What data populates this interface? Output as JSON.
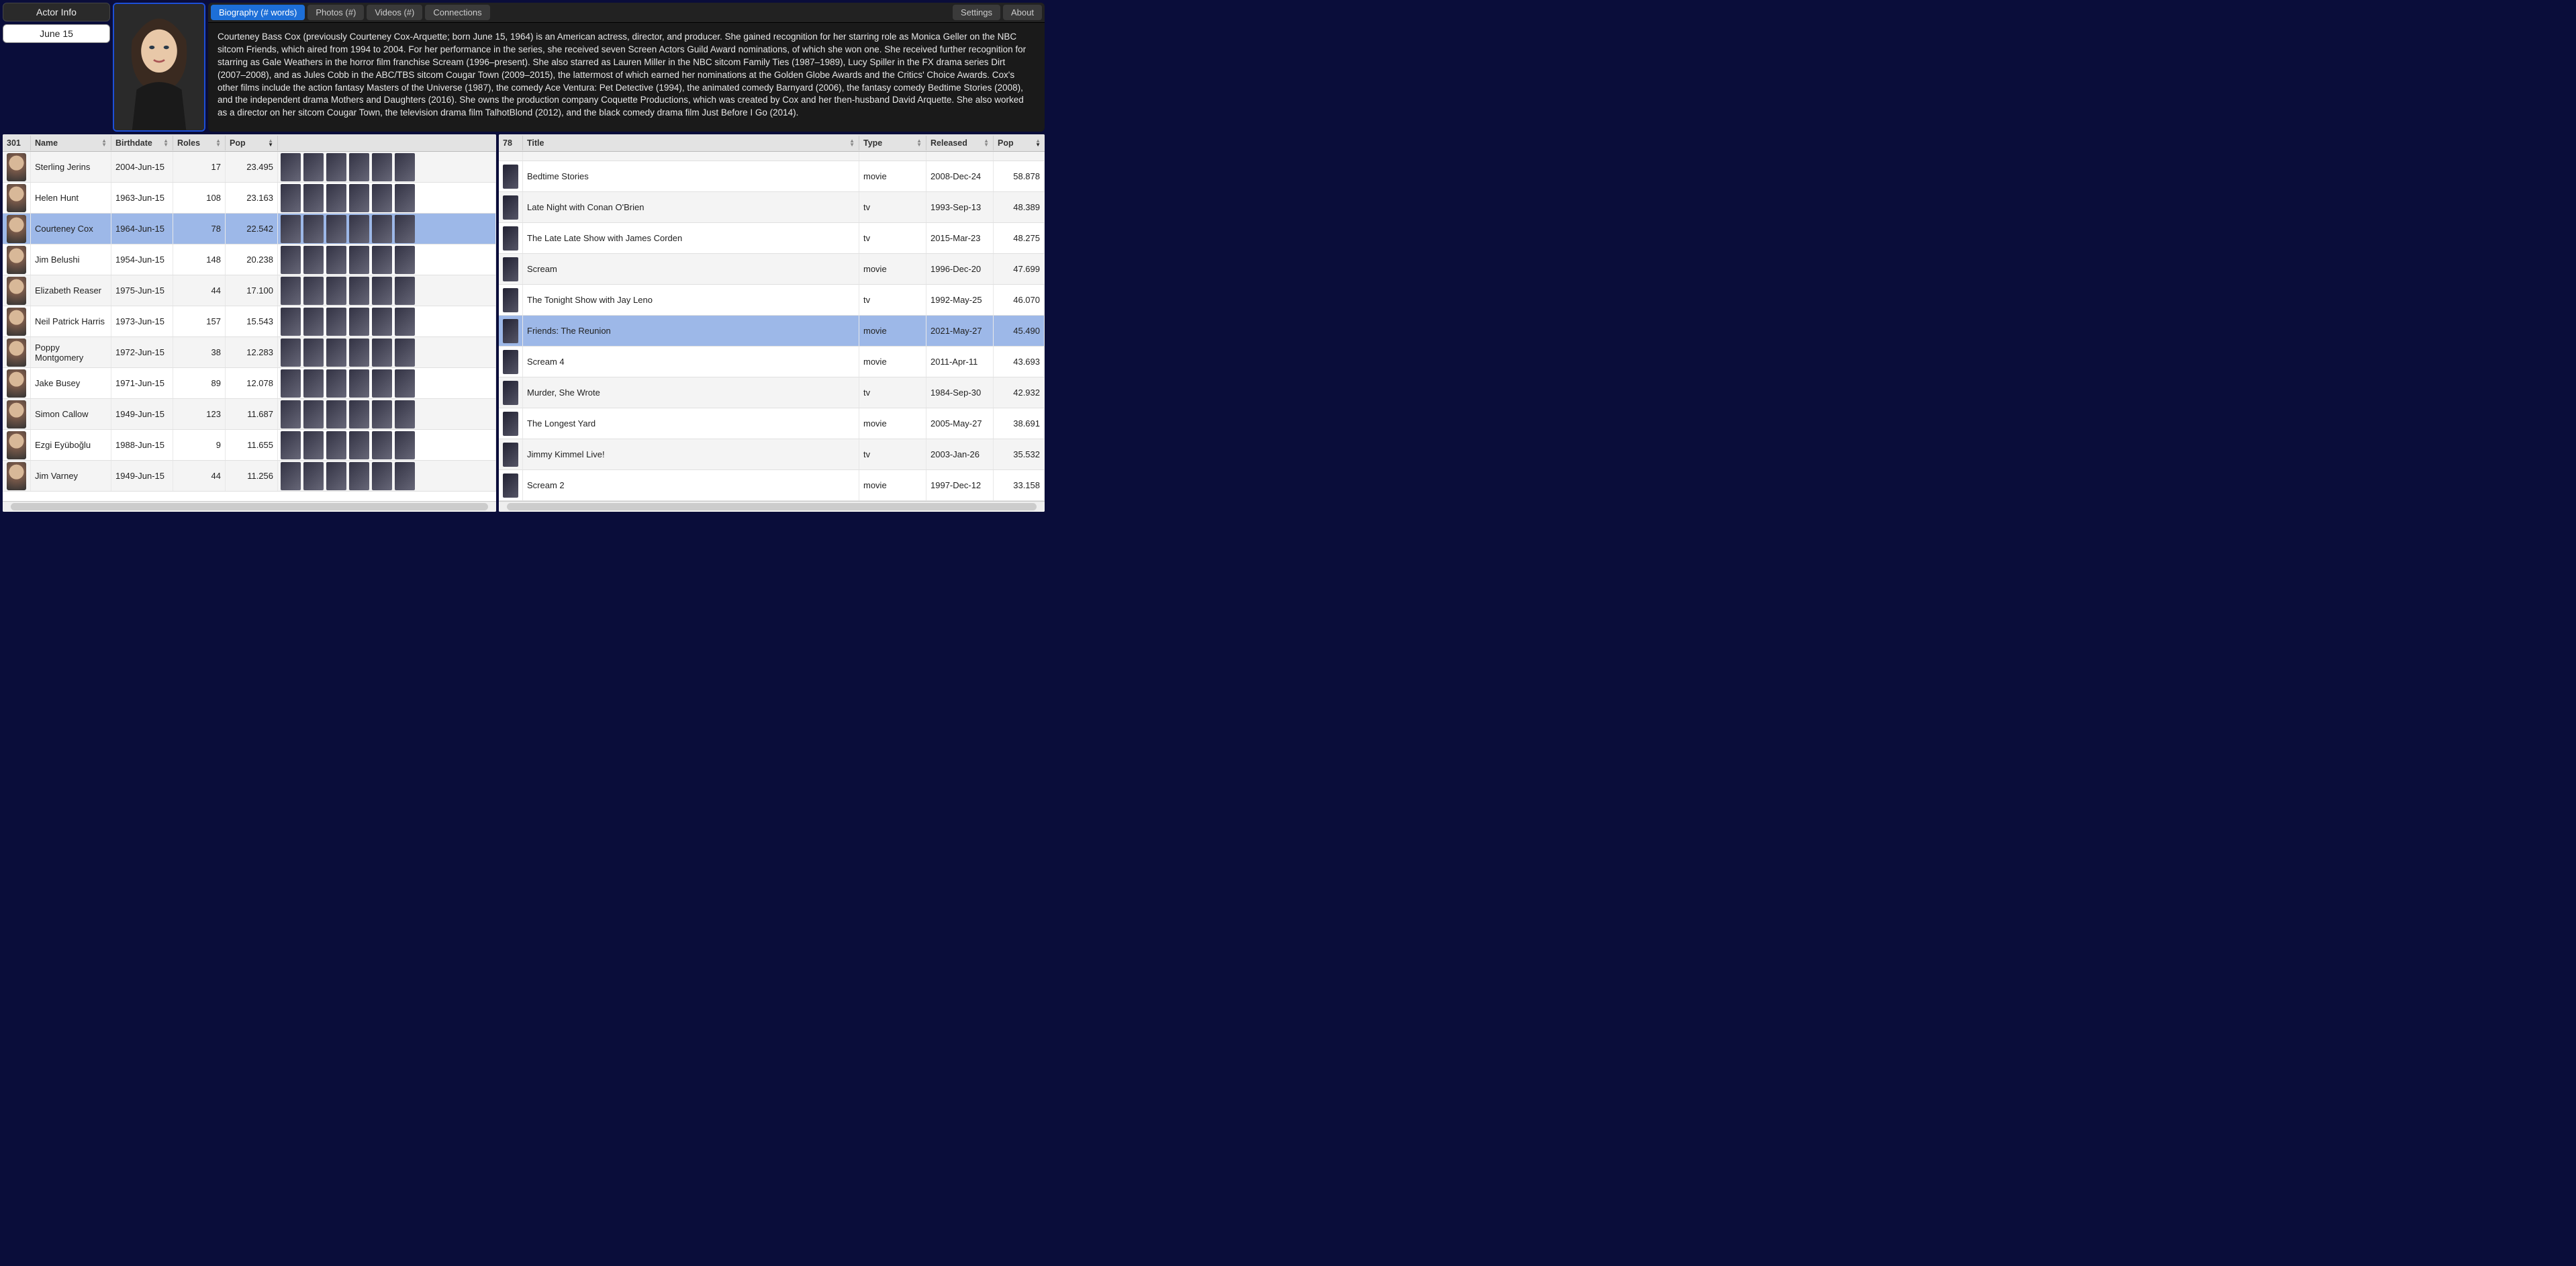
{
  "header": {
    "actor_info_label": "Actor Info",
    "date_label": "June 15"
  },
  "tabs": {
    "biography": "Biography (# words)",
    "photos": "Photos (#)",
    "videos": "Videos (#)",
    "connections": "Connections",
    "settings": "Settings",
    "about": "About"
  },
  "biography": "Courteney Bass Cox (previously Courteney Cox-Arquette; born June 15, 1964) is an American actress, director, and producer. She gained recognition for her starring role as Monica Geller on the NBC sitcom Friends, which aired from 1994 to 2004. For her performance in the series, she received seven Screen Actors Guild Award nominations, of which she won one. She received further recognition for starring as Gale Weathers in the horror film franchise Scream (1996–present). She also starred as Lauren Miller in the NBC sitcom Family Ties (1987–1989), Lucy Spiller in the FX drama series Dirt (2007–2008), and as Jules Cobb in the ABC/TBS sitcom Cougar Town (2009–2015), the lattermost of which earned her nominations at the Golden Globe Awards and the Critics' Choice Awards. Cox's other films include the action fantasy Masters of the Universe (1987), the comedy Ace Ventura: Pet Detective (1994), the animated comedy Barnyard (2006), the fantasy comedy Bedtime Stories (2008), and the independent drama Mothers and Daughters (2016). She owns the production company Coquette Productions, which was created by Cox and her then-husband David Arquette. She also worked as a director on her sitcom Cougar Town, the television drama film TalhotBlond (2012), and the black comedy drama film Just Before I Go (2014).",
  "left_grid": {
    "count_label": "301",
    "columns": {
      "name": "Name",
      "birthdate": "Birthdate",
      "roles": "Roles",
      "pop": "Pop"
    },
    "selected_index": 2,
    "rows": [
      {
        "name": "Sterling Jerins",
        "birthdate": "2004-Jun-15",
        "roles": "17",
        "pop": "23.495"
      },
      {
        "name": "Helen Hunt",
        "birthdate": "1963-Jun-15",
        "roles": "108",
        "pop": "23.163"
      },
      {
        "name": "Courteney Cox",
        "birthdate": "1964-Jun-15",
        "roles": "78",
        "pop": "22.542"
      },
      {
        "name": "Jim Belushi",
        "birthdate": "1954-Jun-15",
        "roles": "148",
        "pop": "20.238"
      },
      {
        "name": "Elizabeth Reaser",
        "birthdate": "1975-Jun-15",
        "roles": "44",
        "pop": "17.100"
      },
      {
        "name": "Neil Patrick Harris",
        "birthdate": "1973-Jun-15",
        "roles": "157",
        "pop": "15.543"
      },
      {
        "name": "Poppy Montgomery",
        "birthdate": "1972-Jun-15",
        "roles": "38",
        "pop": "12.283"
      },
      {
        "name": "Jake Busey",
        "birthdate": "1971-Jun-15",
        "roles": "89",
        "pop": "12.078"
      },
      {
        "name": "Simon Callow",
        "birthdate": "1949-Jun-15",
        "roles": "123",
        "pop": "11.687"
      },
      {
        "name": "Ezgi Eyüboğlu",
        "birthdate": "1988-Jun-15",
        "roles": "9",
        "pop": "11.655"
      },
      {
        "name": "Jim Varney",
        "birthdate": "1949-Jun-15",
        "roles": "44",
        "pop": "11.256"
      }
    ]
  },
  "right_grid": {
    "count_label": "78",
    "columns": {
      "title": "Title",
      "type": "Type",
      "released": "Released",
      "pop": "Pop"
    },
    "selected_index": 5,
    "rows": [
      {
        "title": "Bedtime Stories",
        "type": "movie",
        "released": "2008-Dec-24",
        "pop": "58.878"
      },
      {
        "title": "Late Night with Conan O'Brien",
        "type": "tv",
        "released": "1993-Sep-13",
        "pop": "48.389"
      },
      {
        "title": "The Late Late Show with James Corden",
        "type": "tv",
        "released": "2015-Mar-23",
        "pop": "48.275"
      },
      {
        "title": "Scream",
        "type": "movie",
        "released": "1996-Dec-20",
        "pop": "47.699"
      },
      {
        "title": "The Tonight Show with Jay Leno",
        "type": "tv",
        "released": "1992-May-25",
        "pop": "46.070"
      },
      {
        "title": "Friends: The Reunion",
        "type": "movie",
        "released": "2021-May-27",
        "pop": "45.490"
      },
      {
        "title": "Scream 4",
        "type": "movie",
        "released": "2011-Apr-11",
        "pop": "43.693"
      },
      {
        "title": "Murder, She Wrote",
        "type": "tv",
        "released": "1984-Sep-30",
        "pop": "42.932"
      },
      {
        "title": "The Longest Yard",
        "type": "movie",
        "released": "2005-May-27",
        "pop": "38.691"
      },
      {
        "title": "Jimmy Kimmel Live!",
        "type": "tv",
        "released": "2003-Jan-26",
        "pop": "35.532"
      },
      {
        "title": "Scream 2",
        "type": "movie",
        "released": "1997-Dec-12",
        "pop": "33.158"
      }
    ]
  }
}
